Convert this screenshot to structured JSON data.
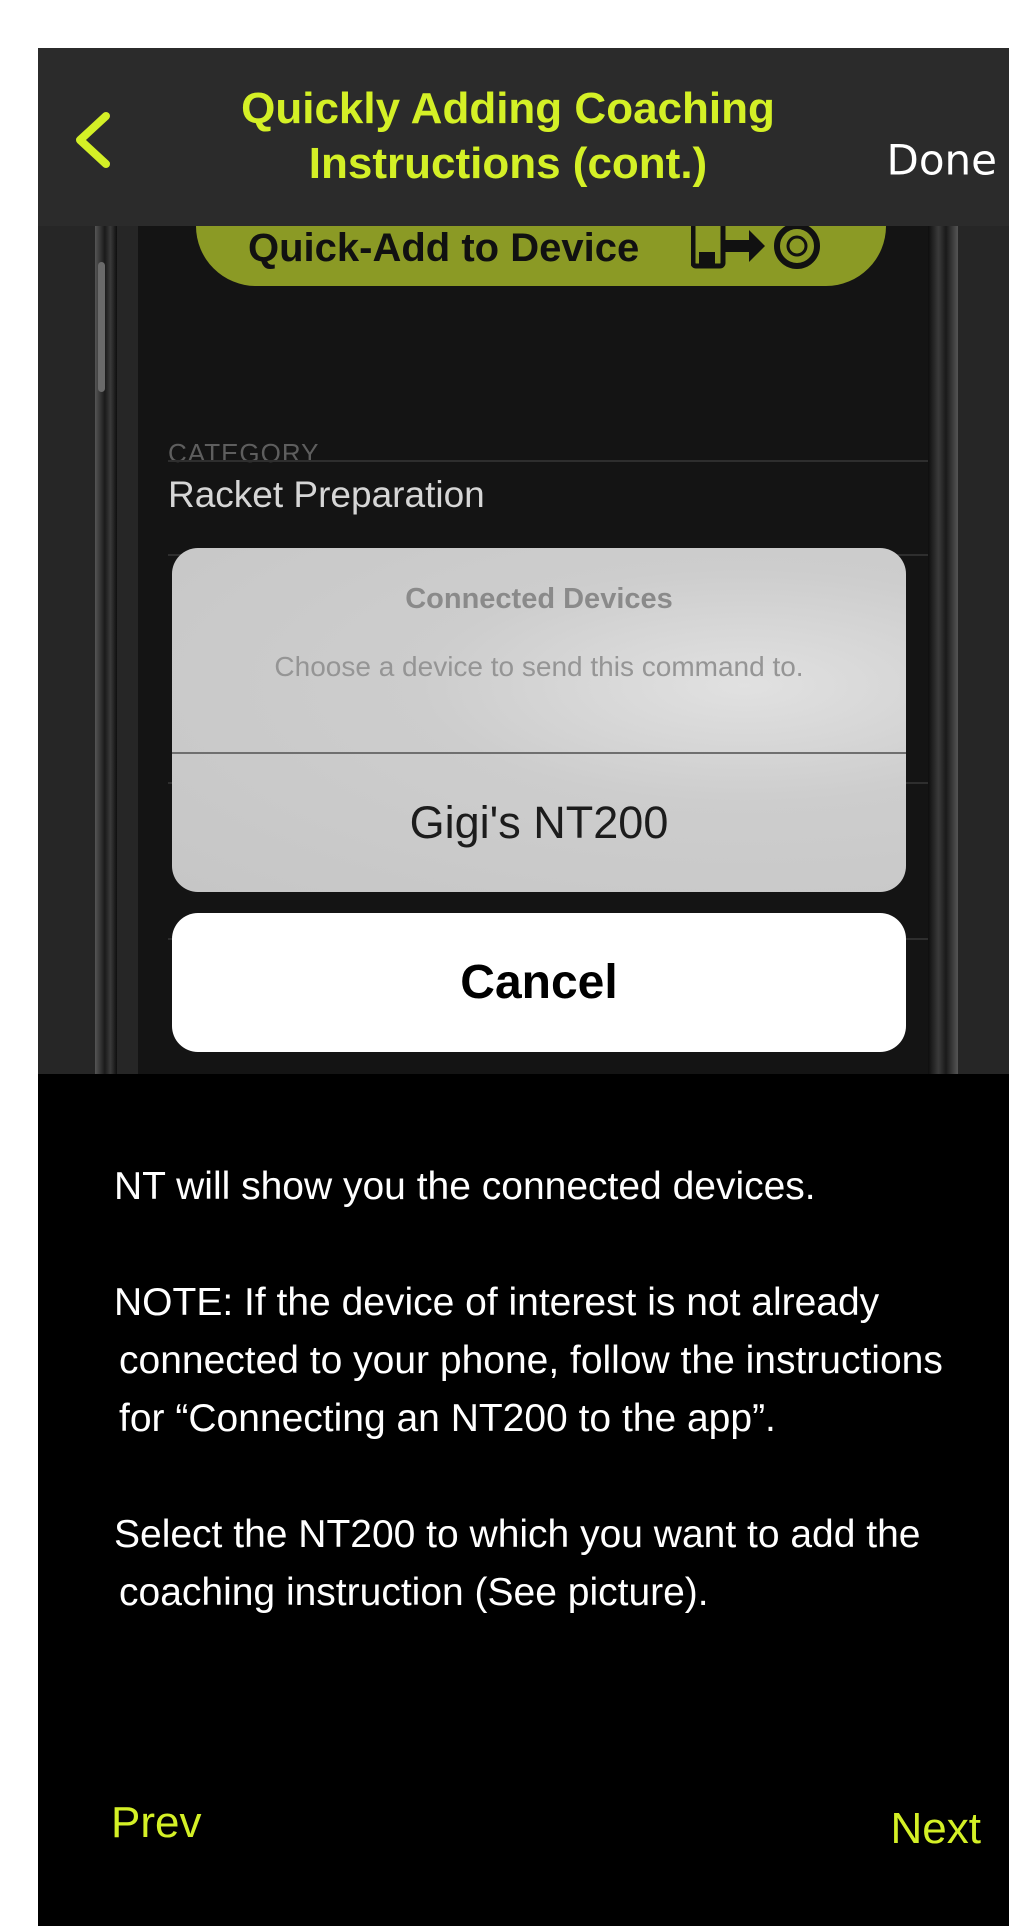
{
  "header": {
    "title_line1": "Quickly Adding Coaching",
    "title_line2": "Instructions (cont.)",
    "done_label": "Done"
  },
  "screenshot": {
    "quick_add_label": "Quick-Add to Device",
    "category_label": "CATEGORY",
    "category_value": "Racket Preparation",
    "action_sheet": {
      "title": "Connected Devices",
      "message": "Choose a device to send this command to.",
      "options": [
        "Gigi's NT200"
      ],
      "cancel_label": "Cancel"
    }
  },
  "instructions": {
    "paragraphs": [
      "NT will show you the connected devices.",
      "NOTE: If the device of interest is not already connected to your phone, follow the instructions for “Connecting an NT200 to the app”.",
      "Select the NT200 to which you want to add the coaching instruction (See picture)."
    ]
  },
  "nav": {
    "prev_label": "Prev",
    "next_label": "Next"
  },
  "colors": {
    "accent": "#d4f026",
    "header_bg": "#2b2b2b",
    "page_bg": "#000000"
  },
  "icons": [
    "chevron-left-icon",
    "phone-transfer-icon",
    "watch-icon"
  ]
}
